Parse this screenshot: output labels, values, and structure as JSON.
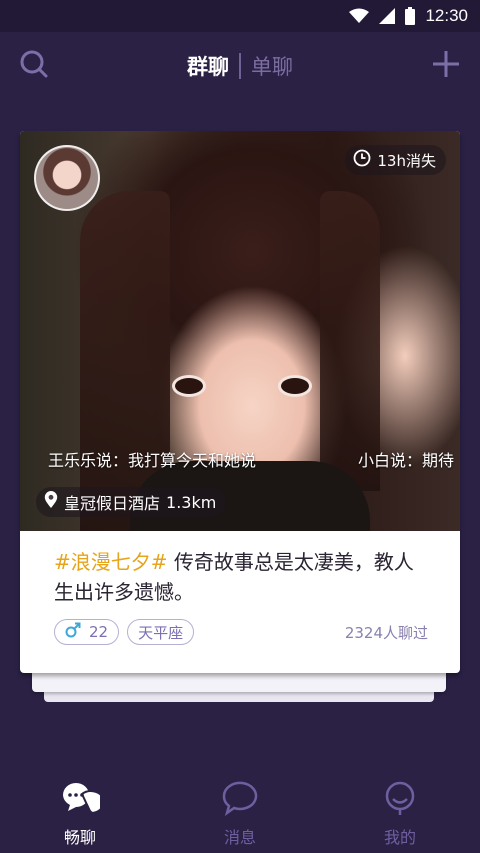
{
  "status_bar": {
    "time": "12:30",
    "icons": [
      "wifi-icon",
      "signal-icon",
      "battery-icon"
    ]
  },
  "top_nav": {
    "tabs": [
      {
        "label": "群聊",
        "active": true
      },
      {
        "label": "单聊",
        "active": false
      }
    ],
    "icons": {
      "left": "search-icon",
      "right": "plus-icon"
    }
  },
  "card": {
    "timer": "13h消失",
    "comments": [
      "王乐乐说：我打算今天和她说",
      "小白说：期待"
    ],
    "location": "皇冠假日酒店",
    "distance": "1.3km",
    "hashtag": "#浪漫七夕#",
    "description": " 传奇故事总是太凄美，教人生出许多遗憾。",
    "gender_icon": "male-icon",
    "age": "22",
    "zodiac": "天平座",
    "chat_count": "2324人聊过"
  },
  "bottom_nav": [
    {
      "label": "畅聊",
      "icon": "chat-bubbles-icon",
      "active": true
    },
    {
      "label": "消息",
      "icon": "message-icon",
      "active": false
    },
    {
      "label": "我的",
      "icon": "profile-icon",
      "active": false
    }
  ],
  "colors": {
    "background": "#2b2145",
    "accent": "#7d6fb2",
    "hashtag": "#e7a41a",
    "card": "#ffffff"
  }
}
